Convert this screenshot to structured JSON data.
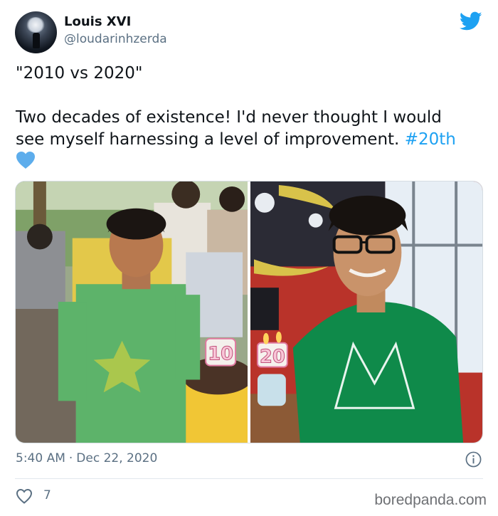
{
  "user": {
    "display_name": "Louis XVI",
    "handle": "@loudarinhzerda",
    "avatar_icon": "moon-avatar"
  },
  "tweet": {
    "title_line": "\"2010 vs 2020\"",
    "body_line1": "Two decades of existence! I'd never thought I would",
    "body_line2_prefix": "see myself harnessing a level of improvement. ",
    "hashtag": "#20th",
    "emoji": "blue-heart-icon"
  },
  "media": {
    "left_candle": "10",
    "right_candle": "20"
  },
  "meta": {
    "time": "5:40 AM",
    "separator": "·",
    "date": "Dec 22, 2020"
  },
  "actions": {
    "like_count": "7"
  },
  "watermark": "boredpanda.com",
  "colors": {
    "accent": "#1da1f2",
    "secondary_text": "#5b7083",
    "divider": "#e1e8ed"
  }
}
